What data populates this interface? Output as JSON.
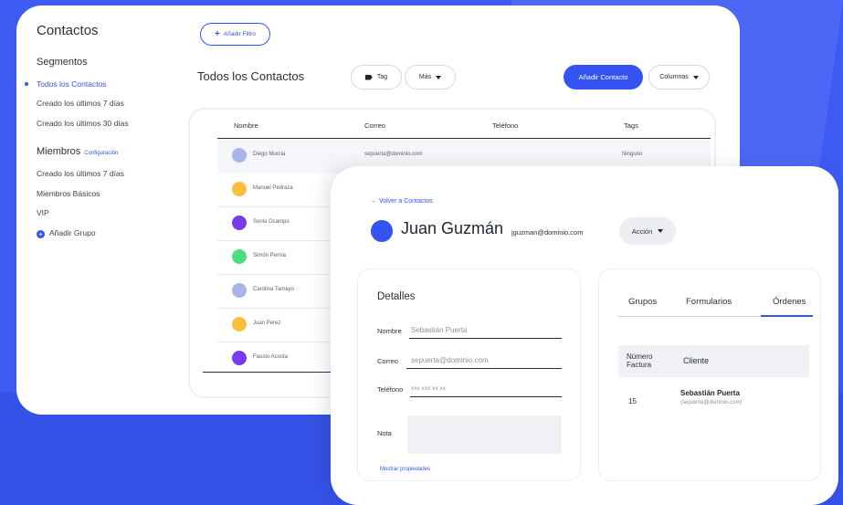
{
  "sidebar": {
    "title": "Contactos",
    "segments_heading": "Segmentos",
    "segments": [
      "Todos los Contactos",
      "Creado los últimos 7 días",
      "Creado los últimos 30 días"
    ],
    "members_heading": "Miembros",
    "config_link": "Configuración",
    "members": [
      "Creado los últimos 7 días",
      "Miembros Básicos",
      "VIP"
    ],
    "add_group": "Añadir Grupo"
  },
  "toolbar": {
    "filter_label": "Añadir Filtro",
    "heading": "Todos los Contactos",
    "tag_label": "Tag",
    "more_label": "Más",
    "add_contact_label": "Añadir Contacto",
    "columns_label": "Columnas"
  },
  "table": {
    "headers": [
      "Nombre",
      "Correo",
      "Teléfono",
      "Tags"
    ],
    "rows": [
      {
        "name": "Diego Murcia",
        "email": "sepuerta@dominio.com",
        "tags": "Ninguno",
        "color": "#a9b3ec"
      },
      {
        "name": "Manuel Pedraza",
        "color": "#fbbf3b"
      },
      {
        "name": "Sonia Ocampo",
        "color": "#7c3aed"
      },
      {
        "name": "Simón Pernia",
        "color": "#4ade80"
      },
      {
        "name": "Carolina Tamayo",
        "color": "#a9b3ec"
      },
      {
        "name": "Juan Perez",
        "color": "#fbbf3b"
      },
      {
        "name": "Fausto Acosta",
        "color": "#7c3aed"
      }
    ]
  },
  "detail": {
    "back_label": "Volver a Contactos",
    "name": "Juan Guzmán",
    "email": "jguzman@dominio.com",
    "action_label": "Acción",
    "details_title": "Detalles",
    "fields": {
      "name_label": "Nombre",
      "name_value": "Sebastián Puerta",
      "email_label": "Correo",
      "email_value": "sepuerta@dominio.com",
      "phone_label": "Teléfono",
      "phone_value": "xxx xxx xx xx",
      "note_label": "Nota"
    },
    "more_props": "Mostrar propiedades"
  },
  "orders": {
    "tabs": [
      "Grupos",
      "Formularios",
      "Órdenes"
    ],
    "head_num": "Número Factura",
    "head_client": "Cliente",
    "row": {
      "num": "15",
      "client": "Sebastián Puerta",
      "client_email": "(sepuerta@dominio.com)"
    }
  },
  "colors": {
    "accent": "#3553f1",
    "background": "#3d5bf0"
  }
}
